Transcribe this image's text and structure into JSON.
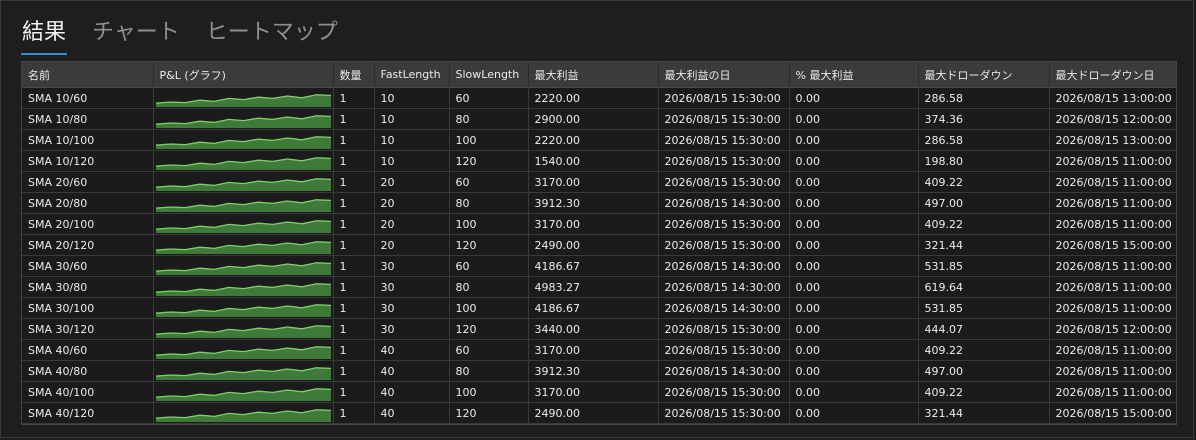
{
  "tabs": [
    {
      "label": "結果",
      "active": true
    },
    {
      "label": "チャート",
      "active": false
    },
    {
      "label": "ヒートマップ",
      "active": false
    }
  ],
  "columns": [
    "名前",
    "P&L (グラフ)",
    "数量",
    "FastLength",
    "SlowLength",
    "最大利益",
    "最大利益の日",
    "% 最大利益",
    "最大ドローダウン",
    "最大ドローダウン日"
  ],
  "rows": [
    {
      "name": "SMA 10/60",
      "qty": "1",
      "fast": "10",
      "slow": "60",
      "max_profit": "2220.00",
      "max_profit_date": "2026/08/15 15:30:00",
      "pct_max_profit": "0.00",
      "max_dd": "286.58",
      "max_dd_date": "2026/08/15 13:00:00"
    },
    {
      "name": "SMA 10/80",
      "qty": "1",
      "fast": "10",
      "slow": "80",
      "max_profit": "2900.00",
      "max_profit_date": "2026/08/15 15:30:00",
      "pct_max_profit": "0.00",
      "max_dd": "374.36",
      "max_dd_date": "2026/08/15 12:00:00"
    },
    {
      "name": "SMA 10/100",
      "qty": "1",
      "fast": "10",
      "slow": "100",
      "max_profit": "2220.00",
      "max_profit_date": "2026/08/15 15:30:00",
      "pct_max_profit": "0.00",
      "max_dd": "286.58",
      "max_dd_date": "2026/08/15 13:00:00"
    },
    {
      "name": "SMA 10/120",
      "qty": "1",
      "fast": "10",
      "slow": "120",
      "max_profit": "1540.00",
      "max_profit_date": "2026/08/15 15:30:00",
      "pct_max_profit": "0.00",
      "max_dd": "198.80",
      "max_dd_date": "2026/08/15 11:00:00"
    },
    {
      "name": "SMA 20/60",
      "qty": "1",
      "fast": "20",
      "slow": "60",
      "max_profit": "3170.00",
      "max_profit_date": "2026/08/15 15:30:00",
      "pct_max_profit": "0.00",
      "max_dd": "409.22",
      "max_dd_date": "2026/08/15 11:00:00"
    },
    {
      "name": "SMA 20/80",
      "qty": "1",
      "fast": "20",
      "slow": "80",
      "max_profit": "3912.30",
      "max_profit_date": "2026/08/15 14:30:00",
      "pct_max_profit": "0.00",
      "max_dd": "497.00",
      "max_dd_date": "2026/08/15 11:00:00"
    },
    {
      "name": "SMA 20/100",
      "qty": "1",
      "fast": "20",
      "slow": "100",
      "max_profit": "3170.00",
      "max_profit_date": "2026/08/15 15:30:00",
      "pct_max_profit": "0.00",
      "max_dd": "409.22",
      "max_dd_date": "2026/08/15 11:00:00"
    },
    {
      "name": "SMA 20/120",
      "qty": "1",
      "fast": "20",
      "slow": "120",
      "max_profit": "2490.00",
      "max_profit_date": "2026/08/15 15:30:00",
      "pct_max_profit": "0.00",
      "max_dd": "321.44",
      "max_dd_date": "2026/08/15 15:00:00"
    },
    {
      "name": "SMA 30/60",
      "qty": "1",
      "fast": "30",
      "slow": "60",
      "max_profit": "4186.67",
      "max_profit_date": "2026/08/15 14:30:00",
      "pct_max_profit": "0.00",
      "max_dd": "531.85",
      "max_dd_date": "2026/08/15 11:00:00"
    },
    {
      "name": "SMA 30/80",
      "qty": "1",
      "fast": "30",
      "slow": "80",
      "max_profit": "4983.27",
      "max_profit_date": "2026/08/15 14:30:00",
      "pct_max_profit": "0.00",
      "max_dd": "619.64",
      "max_dd_date": "2026/08/15 11:00:00"
    },
    {
      "name": "SMA 30/100",
      "qty": "1",
      "fast": "30",
      "slow": "100",
      "max_profit": "4186.67",
      "max_profit_date": "2026/08/15 14:30:00",
      "pct_max_profit": "0.00",
      "max_dd": "531.85",
      "max_dd_date": "2026/08/15 11:00:00"
    },
    {
      "name": "SMA 30/120",
      "qty": "1",
      "fast": "30",
      "slow": "120",
      "max_profit": "3440.00",
      "max_profit_date": "2026/08/15 15:30:00",
      "pct_max_profit": "0.00",
      "max_dd": "444.07",
      "max_dd_date": "2026/08/15 12:00:00"
    },
    {
      "name": "SMA 40/60",
      "qty": "1",
      "fast": "40",
      "slow": "60",
      "max_profit": "3170.00",
      "max_profit_date": "2026/08/15 15:30:00",
      "pct_max_profit": "0.00",
      "max_dd": "409.22",
      "max_dd_date": "2026/08/15 11:00:00"
    },
    {
      "name": "SMA 40/80",
      "qty": "1",
      "fast": "40",
      "slow": "80",
      "max_profit": "3912.30",
      "max_profit_date": "2026/08/15 14:30:00",
      "pct_max_profit": "0.00",
      "max_dd": "497.00",
      "max_dd_date": "2026/08/15 11:00:00"
    },
    {
      "name": "SMA 40/100",
      "qty": "1",
      "fast": "40",
      "slow": "100",
      "max_profit": "3170.00",
      "max_profit_date": "2026/08/15 15:30:00",
      "pct_max_profit": "0.00",
      "max_dd": "409.22",
      "max_dd_date": "2026/08/15 11:00:00"
    },
    {
      "name": "SMA 40/120",
      "qty": "1",
      "fast": "40",
      "slow": "120",
      "max_profit": "2490.00",
      "max_profit_date": "2026/08/15 15:30:00",
      "pct_max_profit": "0.00",
      "max_dd": "321.44",
      "max_dd_date": "2026/08/15 15:00:00"
    }
  ],
  "sparkline": {
    "line_color": "#7fd06a",
    "fill_color": "#3f7a3a",
    "values": [
      0.15,
      0.25,
      0.2,
      0.4,
      0.3,
      0.55,
      0.45,
      0.65,
      0.55,
      0.75,
      0.6,
      0.85,
      0.8
    ]
  }
}
